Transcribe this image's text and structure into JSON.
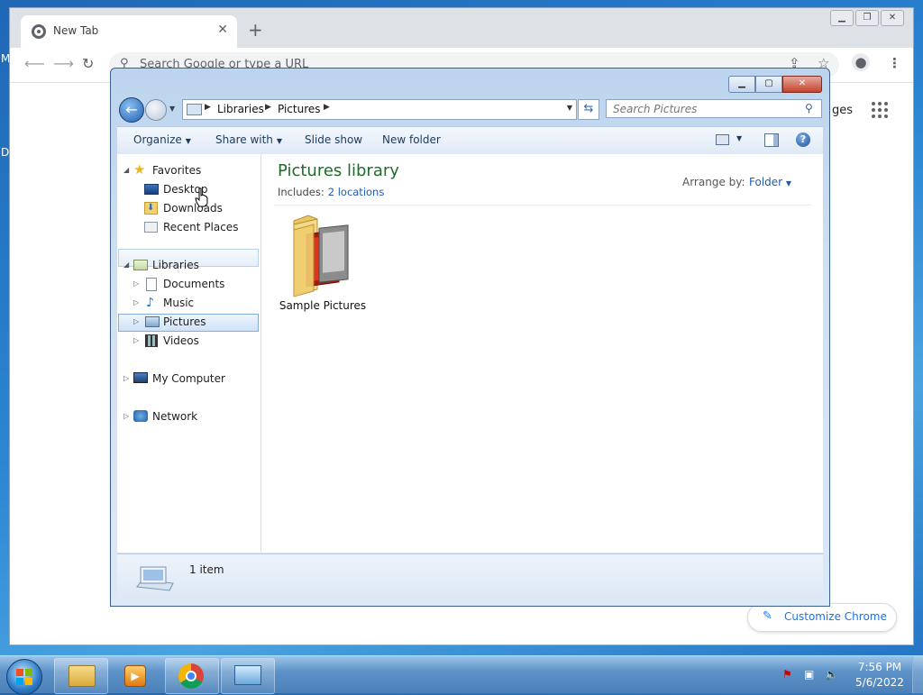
{
  "desktop": {
    "edge_letters": [
      "M",
      "D"
    ]
  },
  "chrome": {
    "tab_title": "New Tab",
    "tab_close": "✕",
    "new_tab": "+",
    "omnibox_placeholder": "Search Google or type a URL",
    "images_link": "ges",
    "customize_label": "Customize Chrome",
    "window_buttons": [
      "▁",
      "❐",
      "✕"
    ]
  },
  "explorer": {
    "breadcrumb": [
      "Libraries",
      "Pictures"
    ],
    "search_placeholder": "Search Pictures",
    "toolbar": {
      "organize": "Organize",
      "share_with": "Share with",
      "slide_show": "Slide show",
      "new_folder": "New folder"
    },
    "nav": {
      "favorites": {
        "label": "Favorites",
        "items": [
          "Desktop",
          "Downloads",
          "Recent Places"
        ]
      },
      "libraries": {
        "label": "Libraries",
        "items": [
          "Documents",
          "Music",
          "Pictures",
          "Videos"
        ]
      },
      "computer": "My Computer",
      "network": "Network"
    },
    "selected_nav_item": "Pictures",
    "hovered_nav_item": "Desktop",
    "library_title": "Pictures library",
    "includes_label": "Includes:",
    "includes_link": "2 locations",
    "arrange_label": "Arrange by:",
    "arrange_value": "Folder",
    "items": [
      {
        "name": "Sample Pictures",
        "type": "folder"
      }
    ],
    "status_text": "1 item"
  },
  "taskbar": {
    "time": "7:56 PM",
    "date": "5/6/2022",
    "pinned": [
      "explorer-icon",
      "media-player-icon",
      "chrome-icon",
      "control-panel-icon"
    ]
  },
  "colors": {
    "library_title": "#1e6b2a",
    "link": "#1d5db5",
    "selection": "#cfe2f8"
  }
}
